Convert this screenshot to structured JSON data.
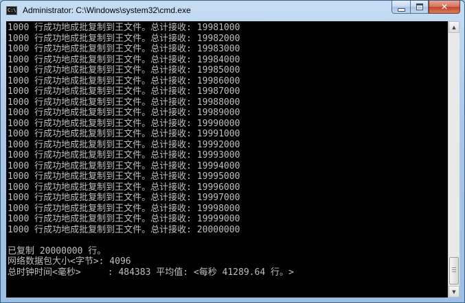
{
  "window": {
    "title": "Administrator: C:\\Windows\\system32\\cmd.exe",
    "icon_label": "C:\\",
    "minimize_icon": "minimize-icon",
    "maximize_icon": "maximize-icon",
    "close_glyph": "✕"
  },
  "console": {
    "lines": [
      "1000 行成功地成批复制到王文件。总计接收: 19981000",
      "1000 行成功地成批复制到王文件。总计接收: 19982000",
      "1000 行成功地成批复制到王文件。总计接收: 19983000",
      "1000 行成功地成批复制到王文件。总计接收: 19984000",
      "1000 行成功地成批复制到王文件。总计接收: 19985000",
      "1000 行成功地成批复制到王文件。总计接收: 19986000",
      "1000 行成功地成批复制到王文件。总计接收: 19987000",
      "1000 行成功地成批复制到王文件。总计接收: 19988000",
      "1000 行成功地成批复制到王文件。总计接收: 19989000",
      "1000 行成功地成批复制到王文件。总计接收: 19990000",
      "1000 行成功地成批复制到王文件。总计接收: 19991000",
      "1000 行成功地成批复制到王文件。总计接收: 19992000",
      "1000 行成功地成批复制到王文件。总计接收: 19993000",
      "1000 行成功地成批复制到王文件。总计接收: 19994000",
      "1000 行成功地成批复制到王文件。总计接收: 19995000",
      "1000 行成功地成批复制到王文件。总计接收: 19996000",
      "1000 行成功地成批复制到王文件。总计接收: 19997000",
      "1000 行成功地成批复制到王文件。总计接收: 19998000",
      "1000 行成功地成批复制到王文件。总计接收: 19999000",
      "1000 行成功地成批复制到王文件。总计接收: 20000000",
      "",
      "已复制 20000000 行。",
      "网络数据包大小<字节>: 4096",
      "总时钟时间<毫秒>     : 484383 平均值: <每秒 41289.64 行。>"
    ]
  },
  "scrollbar": {
    "up_glyph": "▲",
    "down_glyph": "▼"
  }
}
